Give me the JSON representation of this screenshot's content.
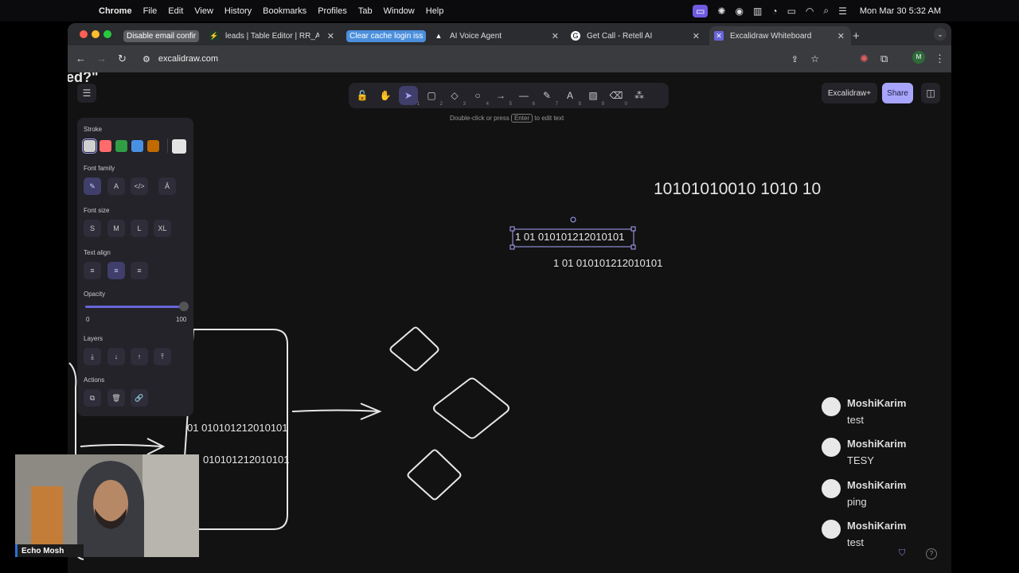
{
  "menubar": {
    "app": "Chrome",
    "items": [
      "File",
      "Edit",
      "View",
      "History",
      "Bookmarks",
      "Profiles",
      "Tab",
      "Window",
      "Help"
    ],
    "clock": "Mon Mar 30  5:32 AM"
  },
  "tabs": [
    {
      "label": "Disable email confir",
      "icon": "tab-pill"
    },
    {
      "label": "leads | Table Editor | RR_Agen",
      "icon": "supabase-icon"
    },
    {
      "label": "Clear cache login iss",
      "icon": "tab-pill"
    },
    {
      "label": "AI Voice Agent",
      "icon": "triangle-icon"
    },
    {
      "label": "Get Call - Retell AI",
      "icon": "retell-icon"
    },
    {
      "label": "Excalidraw Whiteboard",
      "icon": "excalidraw-icon"
    }
  ],
  "address": {
    "url": "excalidraw.com"
  },
  "toolbar": {
    "tools": [
      {
        "name": "lock-tool",
        "glyph": "🔓",
        "key": ""
      },
      {
        "name": "hand-tool",
        "glyph": "✋",
        "key": ""
      },
      {
        "name": "selection-tool",
        "glyph": "➤",
        "key": "1"
      },
      {
        "name": "rectangle-tool",
        "glyph": "▢",
        "key": "2"
      },
      {
        "name": "diamond-tool",
        "glyph": "◇",
        "key": "3"
      },
      {
        "name": "ellipse-tool",
        "glyph": "○",
        "key": "4"
      },
      {
        "name": "arrow-tool",
        "glyph": "→",
        "key": "5"
      },
      {
        "name": "line-tool",
        "glyph": "—",
        "key": "6"
      },
      {
        "name": "draw-tool",
        "glyph": "✎",
        "key": "7"
      },
      {
        "name": "text-tool",
        "glyph": "A",
        "key": "8"
      },
      {
        "name": "image-tool",
        "glyph": "▨",
        "key": "9"
      },
      {
        "name": "eraser-tool",
        "glyph": "⌫",
        "key": "0"
      },
      {
        "name": "more-tools",
        "glyph": "⁂",
        "key": ""
      }
    ],
    "hint_pre": "Double-click or press",
    "hint_key": "Enter",
    "hint_post": "to edit text"
  },
  "top_right": {
    "excalidraw_plus": "Excalidraw+",
    "share": "Share"
  },
  "panel": {
    "stroke_label": "Stroke",
    "stroke_colors": [
      "#d0d0d0",
      "#ff6b6b",
      "#2f9e44",
      "#4a90e2",
      "#c06a00"
    ],
    "current_color": "#e3e3e3",
    "font_family_label": "Font family",
    "font_family_options": [
      "✎",
      "A",
      "</>",
      "Ā"
    ],
    "font_size_label": "Font size",
    "font_sizes": [
      "S",
      "M",
      "L",
      "XL"
    ],
    "text_align_label": "Text align",
    "opacity_label": "Opacity",
    "opacity_min": "0",
    "opacity_max": "100",
    "opacity_value": 100,
    "layers_label": "Layers",
    "actions_label": "Actions"
  },
  "canvas": {
    "text_top_right": "10101010010 1010 10",
    "text_selected": "1 01 010101212010101",
    "text_below_selected": "1 01 010101212010101",
    "text_left_1": "01 010101212010101",
    "text_left_2": "010101212010101",
    "text_corner": "ed?\""
  },
  "chat": [
    {
      "name": "MoshiKarim",
      "msg": "test"
    },
    {
      "name": "MoshiKarim",
      "msg": "TESY"
    },
    {
      "name": "MoshiKarim",
      "msg": "ping"
    },
    {
      "name": "MoshiKarim",
      "msg": "test"
    }
  ],
  "webcam": {
    "label": "Echo Mosh"
  }
}
